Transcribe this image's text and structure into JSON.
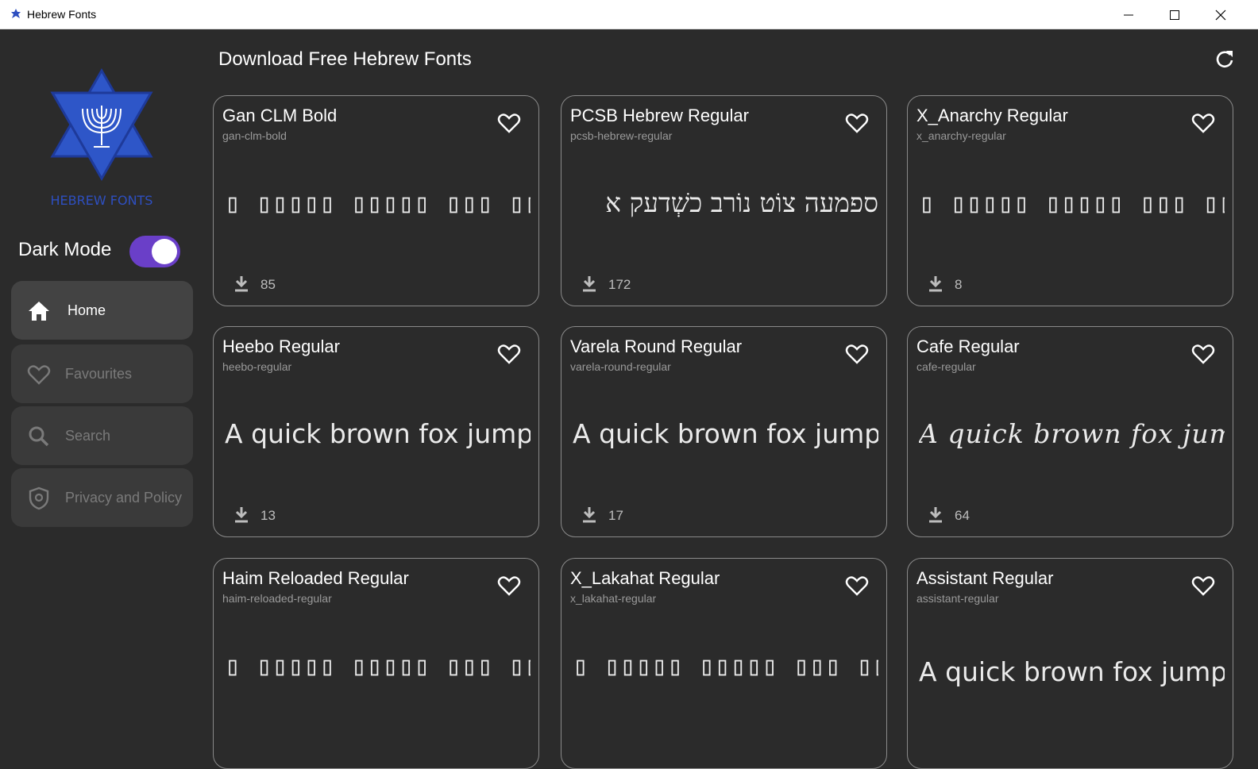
{
  "window": {
    "title": "Hebrew Fonts"
  },
  "sidebar": {
    "logo_text": "HEBREW FONTS",
    "dark_mode_label": "Dark Mode",
    "dark_mode_on": true,
    "items": [
      {
        "label": "Home",
        "icon": "home-icon",
        "active": true
      },
      {
        "label": "Favourites",
        "icon": "heart-icon",
        "active": false
      },
      {
        "label": "Search",
        "icon": "search-icon",
        "active": false
      },
      {
        "label": "Privacy and Policy",
        "icon": "shield-icon",
        "active": false
      }
    ]
  },
  "header": {
    "title": "Download Free Hebrew Fonts"
  },
  "colors": {
    "accent": "#6a3fc8",
    "logo_blue": "#2e4fc0",
    "background": "#2b2b2b"
  },
  "cards": [
    {
      "name": "Gan CLM Bold",
      "slug": "gan-clm-bold",
      "preview": "▯ ▯▯▯▯▯ ▯▯▯▯▯ ▯▯▯ ▯▯▯▯▯ ▯▯▯▯ ▯",
      "downloads": "85"
    },
    {
      "name": "PCSB Hebrew Regular",
      "slug": "pcsb-hebrew-regular",
      "preview": "ספמעה צוֹט נוֹרב כשְׁדעק א",
      "downloads": "172"
    },
    {
      "name": "X_Anarchy Regular",
      "slug": "x_anarchy-regular",
      "preview": "▯ ▯▯▯▯▯ ▯▯▯▯▯ ▯▯▯ ▯▯▯▯▯ ▯▯",
      "downloads": "8"
    },
    {
      "name": "Heebo Regular",
      "slug": "heebo-regular",
      "preview": "A quick brown fox jumps o",
      "downloads": "13"
    },
    {
      "name": "Varela Round Regular",
      "slug": "varela-round-regular",
      "preview": "A quick brown fox jump",
      "downloads": "17"
    },
    {
      "name": "Cafe Regular",
      "slug": "cafe-regular",
      "preview": "A quick brown fox jumps ov",
      "downloads": "64"
    },
    {
      "name": "Haim Reloaded Regular",
      "slug": "haim-reloaded-regular",
      "preview": "▯ ▯▯▯▯▯ ▯▯▯▯▯ ▯▯▯ ▯▯▯▯▯ ▯",
      "downloads": ""
    },
    {
      "name": "X_Lakahat Regular",
      "slug": "x_lakahat-regular",
      "preview": "▯ ▯▯▯▯▯ ▯▯▯▯▯ ▯▯▯ ▯▯▯▯▯ ▯",
      "downloads": ""
    },
    {
      "name": "Assistant Regular",
      "slug": "assistant-regular",
      "preview": "A quick brown fox jumps ov",
      "downloads": ""
    }
  ]
}
